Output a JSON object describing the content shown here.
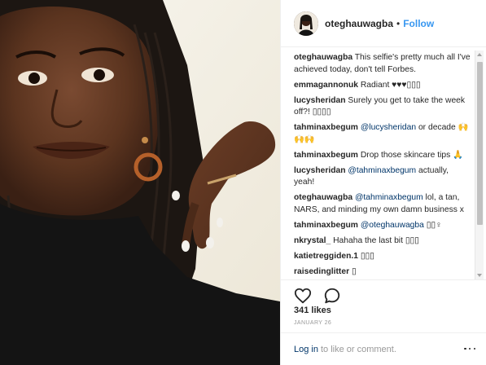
{
  "post": {
    "photo_alt": "selfie",
    "author": "oteghauwagba",
    "separator": "•",
    "follow_label": "Follow"
  },
  "comments": [
    {
      "user": "oteghauwagba",
      "parts": [
        {
          "t": " This selfie's pretty much all I've achieved today, don't tell Forbes."
        }
      ]
    },
    {
      "user": "emmagannonuk",
      "parts": [
        {
          "t": " Radiant ♥♥♥"
        },
        {
          "t": "▯▯▯"
        }
      ]
    },
    {
      "user": "lucysheridan",
      "parts": [
        {
          "t": " Surely you get to take the week off?! ▯▯▯▯"
        }
      ]
    },
    {
      "user": "tahminaxbegum",
      "parts": [
        {
          "m": " @lucysheridan"
        },
        {
          "t": " or decade 🙌🙌🙌"
        }
      ]
    },
    {
      "user": "tahminaxbegum",
      "parts": [
        {
          "t": " Drop those skincare tips 🙏"
        }
      ]
    },
    {
      "user": "lucysheridan",
      "parts": [
        {
          "m": " @tahminaxbegum"
        },
        {
          "t": " actually, yeah!"
        }
      ]
    },
    {
      "user": "oteghauwagba",
      "parts": [
        {
          "m": " @tahminaxbegum"
        },
        {
          "t": " lol, a tan, NARS, and minding my own damn business x"
        }
      ]
    },
    {
      "user": "tahminaxbegum",
      "parts": [
        {
          "m": " @oteghauwagba"
        },
        {
          "t": " ▯▯♀"
        }
      ]
    },
    {
      "user": "nkrystal_",
      "parts": [
        {
          "t": " Hahaha the last bit ▯▯▯"
        }
      ]
    },
    {
      "user": "katietreggiden.1",
      "parts": [
        {
          "t": " ▯▯▯"
        }
      ]
    },
    {
      "user": "raisedinglitter",
      "parts": [
        {
          "t": " ▯"
        }
      ]
    }
  ],
  "actions": {
    "likes": "341 likes",
    "date": "JANUARY 26",
    "login_label": "Log in",
    "comment_prompt": "to like or comment."
  },
  "icons": {
    "like": "heart-icon",
    "comment": "speech-bubble-icon",
    "more": "ellipsis-icon"
  },
  "colors": {
    "link": "#003569",
    "follow": "#3897f0",
    "muted": "#999999",
    "text": "#262626"
  }
}
